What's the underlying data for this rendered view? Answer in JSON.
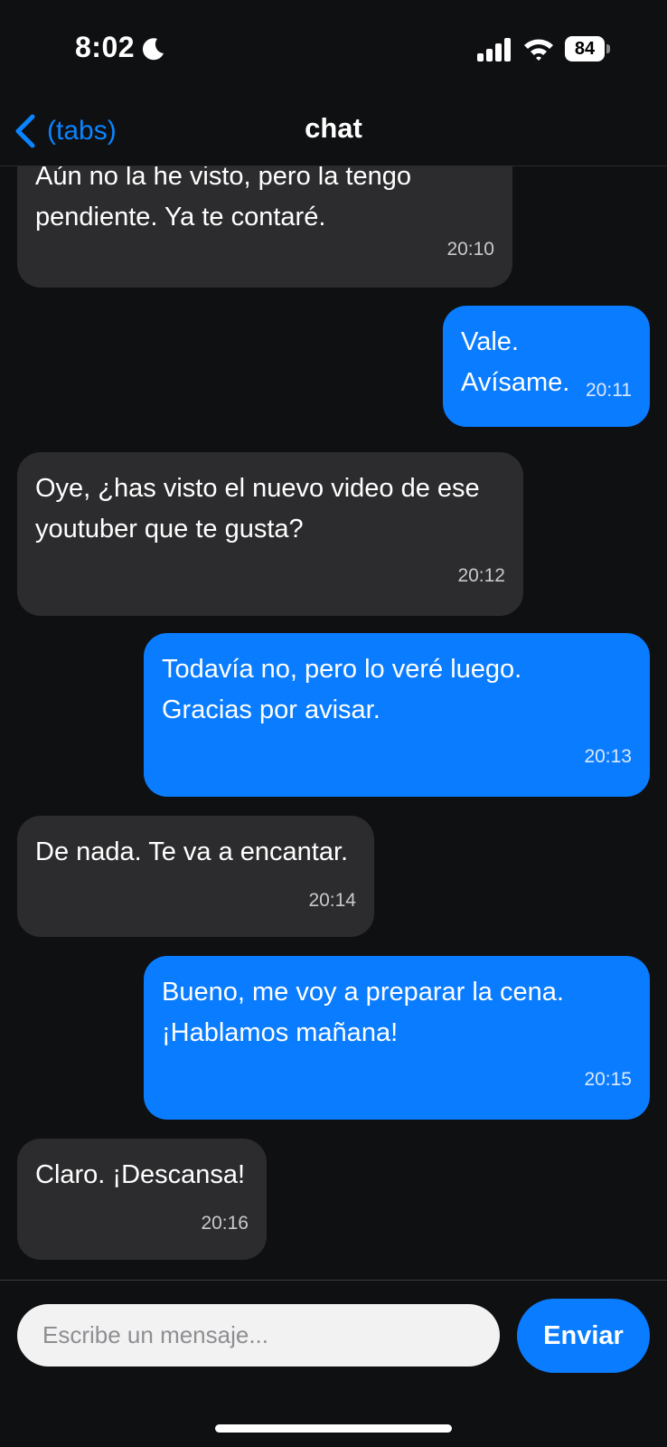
{
  "status_bar": {
    "time": "8:02",
    "battery": "84",
    "icons": [
      "moon-icon",
      "signal-icon",
      "wifi-icon",
      "battery-icon"
    ]
  },
  "nav": {
    "back_label": "(tabs)",
    "title": "chat"
  },
  "messages": [
    {
      "side": "in",
      "text": "Aún no la he visto, pero la tengo\npendiente. Ya te contaré.",
      "time": "20:10"
    },
    {
      "side": "out",
      "text": "Vale. Avísame.",
      "time": "20:11"
    },
    {
      "side": "in",
      "text": "Oye, ¿has visto el nuevo video de ese\nyoutuber que te gusta?",
      "time": "20:12"
    },
    {
      "side": "out",
      "text": "Todavía no, pero lo veré luego.\nGracias por avisar.",
      "time": "20:13"
    },
    {
      "side": "in",
      "text": "De nada. Te va a encantar.",
      "time": "20:14"
    },
    {
      "side": "out",
      "text": "Bueno, me voy a preparar la cena.\n¡Hablamos mañana!",
      "time": "20:15"
    },
    {
      "side": "in",
      "text": "Claro. ¡Descansa!",
      "time": "20:16"
    }
  ],
  "composer": {
    "placeholder": "Escribe un mensaje...",
    "value": "",
    "send_label": "Enviar"
  },
  "colors": {
    "background": "#0f1012",
    "incoming_bubble": "#2c2c2e",
    "outgoing_bubble": "#0a7cff",
    "accent": "#0a84ff"
  }
}
